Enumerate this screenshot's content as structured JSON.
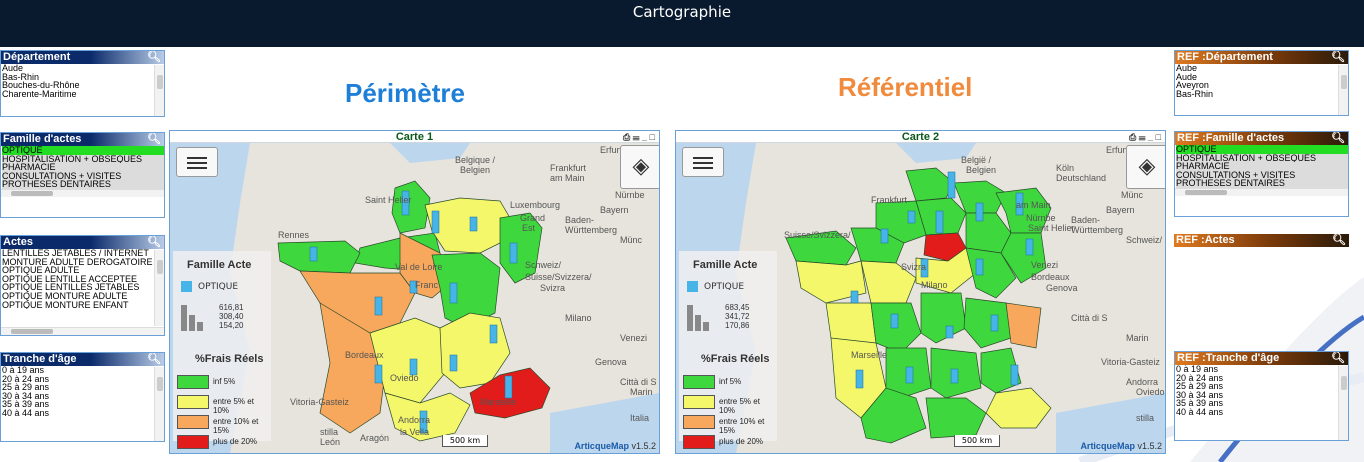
{
  "app": {
    "title": "Cartographie"
  },
  "headings": {
    "perimetre": "Périmètre",
    "referentiel": "Référentiel"
  },
  "colors": {
    "titlebar": "#0a1a2e",
    "selected": "#22dd22",
    "perimetre": "#1e7fd8",
    "referentiel": "#f08a3c",
    "green": "#3ed83e",
    "yellow": "#f4f76a",
    "orange": "#f7a85c",
    "red": "#e21b1b",
    "bars": "#47b4e8"
  },
  "left": {
    "departement": {
      "title": "Département",
      "items": [
        "Aude",
        "Bas-Rhin",
        "Bouches-du-Rhône",
        "Charente-Maritime"
      ]
    },
    "famille": {
      "title": "Famille d'actes",
      "items": [
        "OPTIQUE",
        "HOSPITALISATION + OBSEQUES",
        "PHARMACIE",
        "CONSULTATIONS + VISITES",
        "PROTHESES DENTAIRES"
      ]
    },
    "actes": {
      "title": "Actes",
      "items": [
        "LENTILLES JETABLES / INTERNET",
        "MONTURE ADULTE DEROGATOIRE",
        "OPTIQUE ADULTE",
        "OPTIQUE LENTILLE ACCEPTEE",
        "OPTIQUE LENTILLES JETABLES",
        "OPTIQUE MONTURE ADULTE",
        "OPTIQUE MONTURE ENFANT"
      ]
    },
    "tranche": {
      "title": "Tranche d'âge",
      "items": [
        "0 à 19 ans",
        "20 à 24 ans",
        "25 à 29 ans",
        "30 à 34 ans",
        "35 à 39 ans",
        "40 à 44 ans"
      ]
    }
  },
  "right": {
    "departement": {
      "title": "REF :Département",
      "items": [
        "Aube",
        "Aude",
        "Aveyron",
        "Bas-Rhin"
      ]
    },
    "famille": {
      "title": "REF :Famille d'actes",
      "items": [
        "OPTIQUE",
        "HOSPITALISATION + OBSEQUES",
        "PHARMACIE",
        "CONSULTATIONS + VISITES",
        "PROTHESES DENTAIRES"
      ]
    },
    "actes": {
      "title": "REF :Actes"
    },
    "tranche": {
      "title": "REF :Tranche d'âge",
      "items": [
        "0 à 19 ans",
        "20 à 24 ans",
        "25 à 29 ans",
        "30 à 34 ans",
        "35 à 39 ans",
        "40 à 44 ans"
      ]
    }
  },
  "maps": [
    {
      "title": "Carte 1",
      "legend": {
        "title": "Famille Acte",
        "op": "OPTIQUE",
        "vals": [
          "616,81",
          "308,40",
          "154,20"
        ],
        "pct_title": "%Frais Réels",
        "classes": [
          "inf 5%",
          "entre 5% et 10%",
          "entre 10% et 15%",
          "plus de 20%"
        ]
      },
      "labels": [
        "Belgique /",
        "Belgien",
        "Frankfurt",
        "am Main",
        "Erfurt",
        "Saint Helier",
        "Luxembourg",
        "Grand",
        "Est",
        "Baden-",
        "Württemberg",
        "Bayern",
        "Nürnbe",
        "Münc",
        "Rennes",
        "Val de Loire",
        "Franc",
        "Schweiz/",
        "Suisse/Svizzera/",
        "Svizra",
        "Milano",
        "Venezi",
        "Bordeaux",
        "Genova",
        "Città di S",
        "Marin",
        "Italia",
        "Marseille",
        "Vitoria-Gasteiz",
        "Andorra",
        "la Vella",
        "Aragón",
        "Oviedo",
        "stilla",
        "León"
      ],
      "scale": "500 km",
      "credit": "ArticqueMap",
      "version": "v1.5.2"
    },
    {
      "title": "Carte 2",
      "legend": {
        "title": "Famille Acte",
        "op": "OPTIQUE",
        "vals": [
          "683,45",
          "341,72",
          "170,86"
        ],
        "pct_title": "%Frais Réels",
        "classes": [
          "inf 5%",
          "entre 5% et 10%",
          "entre 10% et 15%",
          "plus de 20%"
        ]
      },
      "labels": [
        "Belgiё /",
        "Belgien",
        "Köln",
        "Deutschland",
        "Erfurt",
        "Frankfurt",
        "am Main",
        "Nürnbe",
        "Saint Helier",
        "Baden-",
        "Württemberg",
        "Bayern",
        "Münc",
        "Schweiz/",
        "Suisse/Svizzera/",
        "Svizra",
        "Milano",
        "Venezi",
        "Bordeaux",
        "Genova",
        "Città di S",
        "Marin",
        "Marseille",
        "Vitoria-Gasteiz",
        "Andorra",
        "Oviedo",
        "stilla"
      ],
      "scale": "500 km",
      "credit": "ArticqueMap",
      "version": "v1.5.2"
    }
  ]
}
